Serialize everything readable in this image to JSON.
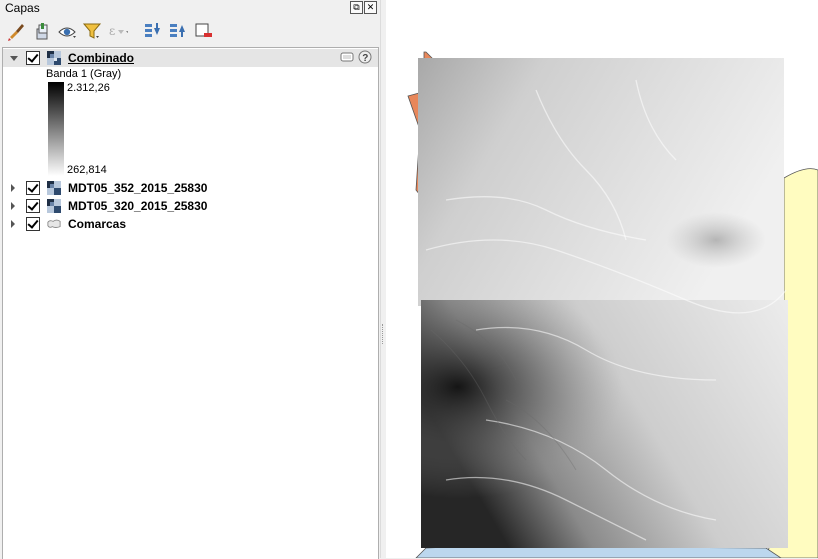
{
  "panel": {
    "title": "Capas",
    "float_button": "⧉",
    "close_button": "✕"
  },
  "toolbar": {
    "icons": [
      "paint-brush-icon",
      "add-group-icon",
      "eye-icon",
      "filter-icon",
      "filter-expression-icon",
      "expand-all-icon",
      "collapse-all-icon",
      "remove-layer-icon"
    ]
  },
  "layers": [
    {
      "name": "Combinado",
      "checked": true,
      "expanded": true,
      "selected": true,
      "type": "raster",
      "legend": {
        "band": "Banda 1 (Gray)",
        "max": "2.312,26",
        "min": "262,814"
      }
    },
    {
      "name": "MDT05_352_2015_25830",
      "checked": true,
      "expanded": false,
      "type": "raster"
    },
    {
      "name": "MDT05_320_2015_25830",
      "checked": true,
      "expanded": false,
      "type": "raster"
    },
    {
      "name": "Comarcas",
      "checked": true,
      "expanded": false,
      "type": "vector-polygon"
    }
  ],
  "map": {
    "colors": {
      "yellow_polygon": "#fffcc0",
      "orange_polygon": "#e8875a",
      "blue_polygon": "#bcd7ee",
      "background": "#ffffff"
    }
  }
}
